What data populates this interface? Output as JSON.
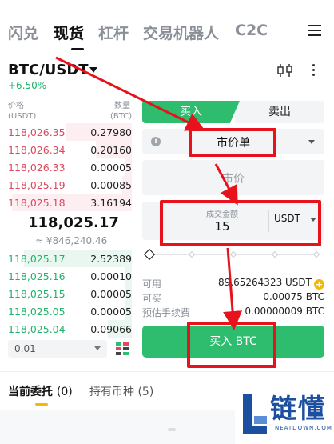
{
  "top_tabs": [
    {
      "label": "闪兑",
      "active": false
    },
    {
      "label": "现货",
      "active": true
    },
    {
      "label": "杠杆",
      "active": false
    },
    {
      "label": "交易机器人",
      "active": false
    },
    {
      "label": "C2C",
      "active": false
    }
  ],
  "pair": {
    "symbol": "BTC/USDT",
    "change": "+6.50%"
  },
  "order_book": {
    "price_header": "价格",
    "price_unit": "(USDT)",
    "amount_header": "数量",
    "amount_unit": "(BTC)",
    "asks": [
      {
        "price": "118,026.35",
        "amount": "0.27980",
        "depth": 0.55
      },
      {
        "price": "118,026.34",
        "amount": "0.20160",
        "depth": 0.3
      },
      {
        "price": "118,026.33",
        "amount": "0.00005",
        "depth": 0.05
      },
      {
        "price": "118,025.19",
        "amount": "0.00085",
        "depth": 0.08
      },
      {
        "price": "118,025.18",
        "amount": "3.16194",
        "depth": 1.0
      }
    ],
    "mid_price": "118,025.17",
    "mid_fiat": "≈ ¥846,240.46",
    "bids": [
      {
        "price": "118,025.17",
        "amount": "2.52389",
        "depth": 0.9
      },
      {
        "price": "118,025.16",
        "amount": "0.00010",
        "depth": 0.06
      },
      {
        "price": "118,025.15",
        "amount": "0.00005",
        "depth": 0.05
      },
      {
        "price": "118,025.05",
        "amount": "0.00005",
        "depth": 0.05
      },
      {
        "price": "118,025.04",
        "amount": "0.09066",
        "depth": 0.2
      }
    ],
    "precision": "0.01"
  },
  "trade": {
    "buy_label": "买入",
    "sell_label": "卖出",
    "order_type": "市价单",
    "price_placeholder": "市价",
    "amount_label": "成交金额",
    "amount_value": "15",
    "amount_unit": "USDT",
    "slider_level": 0,
    "available_label": "可用",
    "available_value": "89.65264323 USDT",
    "can_buy_label": "可买",
    "can_buy_value": "0.00075 BTC",
    "fee_label": "预估手续费",
    "fee_value": "0.00000009 BTC",
    "submit_label": "买入 BTC"
  },
  "bottom_tabs": [
    {
      "label": "当前委托",
      "count": "(0)",
      "active": true
    },
    {
      "label": "持有币种",
      "count": "(5)",
      "active": false
    }
  ],
  "watermark": {
    "text": "链懂",
    "sub": "NEATDOWN.COM"
  },
  "colors": {
    "buy": "#2ebd6f",
    "sell": "#e04760",
    "annotation": "#e8121c",
    "accent": "#f0b90b"
  }
}
